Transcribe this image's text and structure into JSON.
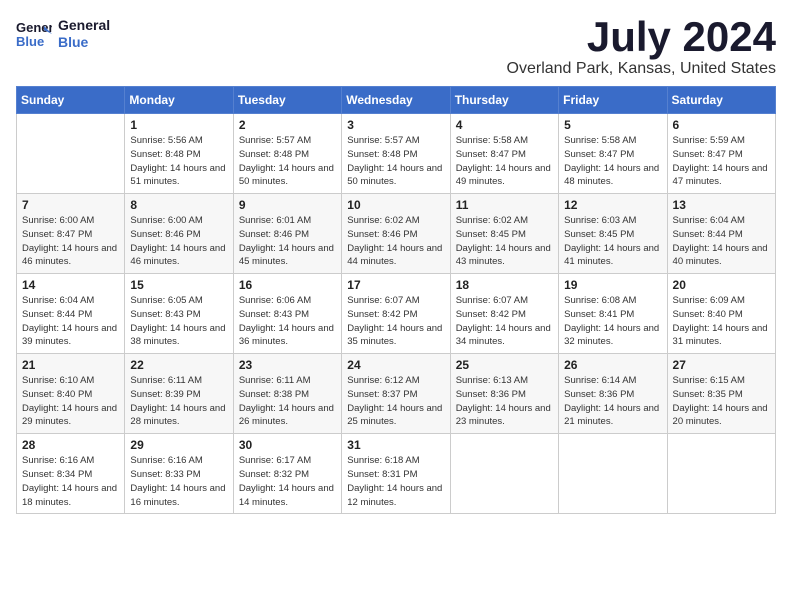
{
  "logo": {
    "line1": "General",
    "line2": "Blue"
  },
  "title": "July 2024",
  "location": "Overland Park, Kansas, United States",
  "days_of_week": [
    "Sunday",
    "Monday",
    "Tuesday",
    "Wednesday",
    "Thursday",
    "Friday",
    "Saturday"
  ],
  "weeks": [
    [
      {
        "day": "",
        "sunrise": "",
        "sunset": "",
        "daylight": ""
      },
      {
        "day": "1",
        "sunrise": "Sunrise: 5:56 AM",
        "sunset": "Sunset: 8:48 PM",
        "daylight": "Daylight: 14 hours and 51 minutes."
      },
      {
        "day": "2",
        "sunrise": "Sunrise: 5:57 AM",
        "sunset": "Sunset: 8:48 PM",
        "daylight": "Daylight: 14 hours and 50 minutes."
      },
      {
        "day": "3",
        "sunrise": "Sunrise: 5:57 AM",
        "sunset": "Sunset: 8:48 PM",
        "daylight": "Daylight: 14 hours and 50 minutes."
      },
      {
        "day": "4",
        "sunrise": "Sunrise: 5:58 AM",
        "sunset": "Sunset: 8:47 PM",
        "daylight": "Daylight: 14 hours and 49 minutes."
      },
      {
        "day": "5",
        "sunrise": "Sunrise: 5:58 AM",
        "sunset": "Sunset: 8:47 PM",
        "daylight": "Daylight: 14 hours and 48 minutes."
      },
      {
        "day": "6",
        "sunrise": "Sunrise: 5:59 AM",
        "sunset": "Sunset: 8:47 PM",
        "daylight": "Daylight: 14 hours and 47 minutes."
      }
    ],
    [
      {
        "day": "7",
        "sunrise": "Sunrise: 6:00 AM",
        "sunset": "Sunset: 8:47 PM",
        "daylight": "Daylight: 14 hours and 46 minutes."
      },
      {
        "day": "8",
        "sunrise": "Sunrise: 6:00 AM",
        "sunset": "Sunset: 8:46 PM",
        "daylight": "Daylight: 14 hours and 46 minutes."
      },
      {
        "day": "9",
        "sunrise": "Sunrise: 6:01 AM",
        "sunset": "Sunset: 8:46 PM",
        "daylight": "Daylight: 14 hours and 45 minutes."
      },
      {
        "day": "10",
        "sunrise": "Sunrise: 6:02 AM",
        "sunset": "Sunset: 8:46 PM",
        "daylight": "Daylight: 14 hours and 44 minutes."
      },
      {
        "day": "11",
        "sunrise": "Sunrise: 6:02 AM",
        "sunset": "Sunset: 8:45 PM",
        "daylight": "Daylight: 14 hours and 43 minutes."
      },
      {
        "day": "12",
        "sunrise": "Sunrise: 6:03 AM",
        "sunset": "Sunset: 8:45 PM",
        "daylight": "Daylight: 14 hours and 41 minutes."
      },
      {
        "day": "13",
        "sunrise": "Sunrise: 6:04 AM",
        "sunset": "Sunset: 8:44 PM",
        "daylight": "Daylight: 14 hours and 40 minutes."
      }
    ],
    [
      {
        "day": "14",
        "sunrise": "Sunrise: 6:04 AM",
        "sunset": "Sunset: 8:44 PM",
        "daylight": "Daylight: 14 hours and 39 minutes."
      },
      {
        "day": "15",
        "sunrise": "Sunrise: 6:05 AM",
        "sunset": "Sunset: 8:43 PM",
        "daylight": "Daylight: 14 hours and 38 minutes."
      },
      {
        "day": "16",
        "sunrise": "Sunrise: 6:06 AM",
        "sunset": "Sunset: 8:43 PM",
        "daylight": "Daylight: 14 hours and 36 minutes."
      },
      {
        "day": "17",
        "sunrise": "Sunrise: 6:07 AM",
        "sunset": "Sunset: 8:42 PM",
        "daylight": "Daylight: 14 hours and 35 minutes."
      },
      {
        "day": "18",
        "sunrise": "Sunrise: 6:07 AM",
        "sunset": "Sunset: 8:42 PM",
        "daylight": "Daylight: 14 hours and 34 minutes."
      },
      {
        "day": "19",
        "sunrise": "Sunrise: 6:08 AM",
        "sunset": "Sunset: 8:41 PM",
        "daylight": "Daylight: 14 hours and 32 minutes."
      },
      {
        "day": "20",
        "sunrise": "Sunrise: 6:09 AM",
        "sunset": "Sunset: 8:40 PM",
        "daylight": "Daylight: 14 hours and 31 minutes."
      }
    ],
    [
      {
        "day": "21",
        "sunrise": "Sunrise: 6:10 AM",
        "sunset": "Sunset: 8:40 PM",
        "daylight": "Daylight: 14 hours and 29 minutes."
      },
      {
        "day": "22",
        "sunrise": "Sunrise: 6:11 AM",
        "sunset": "Sunset: 8:39 PM",
        "daylight": "Daylight: 14 hours and 28 minutes."
      },
      {
        "day": "23",
        "sunrise": "Sunrise: 6:11 AM",
        "sunset": "Sunset: 8:38 PM",
        "daylight": "Daylight: 14 hours and 26 minutes."
      },
      {
        "day": "24",
        "sunrise": "Sunrise: 6:12 AM",
        "sunset": "Sunset: 8:37 PM",
        "daylight": "Daylight: 14 hours and 25 minutes."
      },
      {
        "day": "25",
        "sunrise": "Sunrise: 6:13 AM",
        "sunset": "Sunset: 8:36 PM",
        "daylight": "Daylight: 14 hours and 23 minutes."
      },
      {
        "day": "26",
        "sunrise": "Sunrise: 6:14 AM",
        "sunset": "Sunset: 8:36 PM",
        "daylight": "Daylight: 14 hours and 21 minutes."
      },
      {
        "day": "27",
        "sunrise": "Sunrise: 6:15 AM",
        "sunset": "Sunset: 8:35 PM",
        "daylight": "Daylight: 14 hours and 20 minutes."
      }
    ],
    [
      {
        "day": "28",
        "sunrise": "Sunrise: 6:16 AM",
        "sunset": "Sunset: 8:34 PM",
        "daylight": "Daylight: 14 hours and 18 minutes."
      },
      {
        "day": "29",
        "sunrise": "Sunrise: 6:16 AM",
        "sunset": "Sunset: 8:33 PM",
        "daylight": "Daylight: 14 hours and 16 minutes."
      },
      {
        "day": "30",
        "sunrise": "Sunrise: 6:17 AM",
        "sunset": "Sunset: 8:32 PM",
        "daylight": "Daylight: 14 hours and 14 minutes."
      },
      {
        "day": "31",
        "sunrise": "Sunrise: 6:18 AM",
        "sunset": "Sunset: 8:31 PM",
        "daylight": "Daylight: 14 hours and 12 minutes."
      },
      {
        "day": "",
        "sunrise": "",
        "sunset": "",
        "daylight": ""
      },
      {
        "day": "",
        "sunrise": "",
        "sunset": "",
        "daylight": ""
      },
      {
        "day": "",
        "sunrise": "",
        "sunset": "",
        "daylight": ""
      }
    ]
  ]
}
